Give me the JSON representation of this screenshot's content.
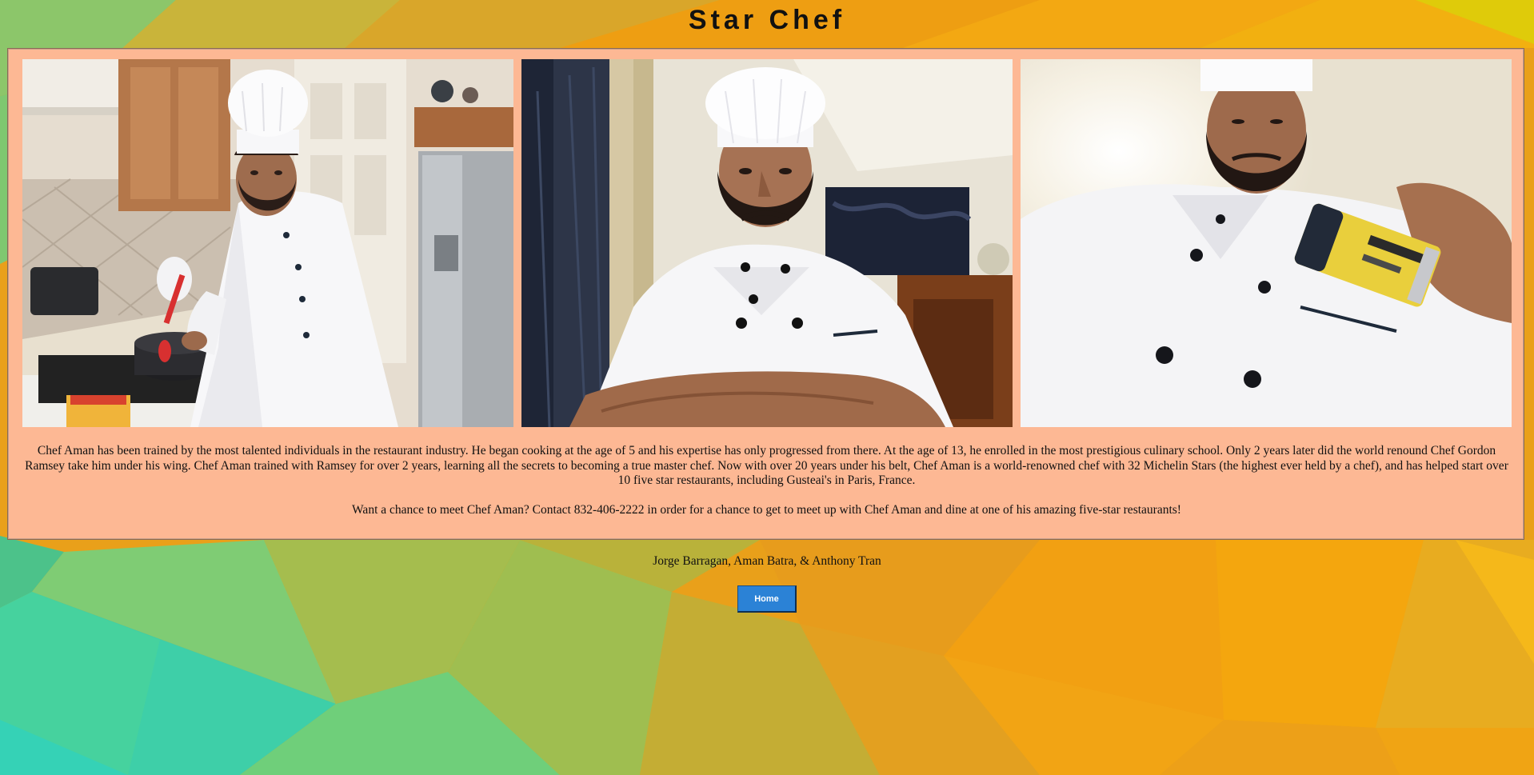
{
  "page": {
    "title": "Star Chef"
  },
  "gallery": {
    "photos": [
      {
        "alt": "Chef Aman cooking at a stove in a kitchen"
      },
      {
        "alt": "Chef Aman with arms crossed"
      },
      {
        "alt": "Chef Aman holding a seasoning shaker"
      }
    ]
  },
  "content": {
    "bio": "Chef Aman has been trained by the most talented individuals in the restaurant industry. He began cooking at the age of 5 and his expertise has only progressed from there. At the age of 13, he enrolled in the most prestigious culinary school. Only 2 years later did the world renound Chef Gordon Ramsey take him under his wing. Chef Aman trained with Ramsey for over 2 years, learning all the secrets to becoming a true master chef. Now with over 20 years under his belt, Chef Aman is a world-renowned chef with 32 Michelin Stars (the highest ever held by a chef), and has helped start over 10 five star restaurants, including Gusteai's in Paris, France.",
    "contact": "Want a chance to meet Chef Aman? Contact 832-406-2222 in order for a chance to get to meet up with Chef Aman and dine at one of his amazing five-star restaurants!"
  },
  "footer": {
    "credits": "Jorge Barragan, Aman Batra, & Anthony Tran",
    "home_label": "Home"
  },
  "colors": {
    "panel": "#fdb894",
    "button": "#2b82d6"
  }
}
